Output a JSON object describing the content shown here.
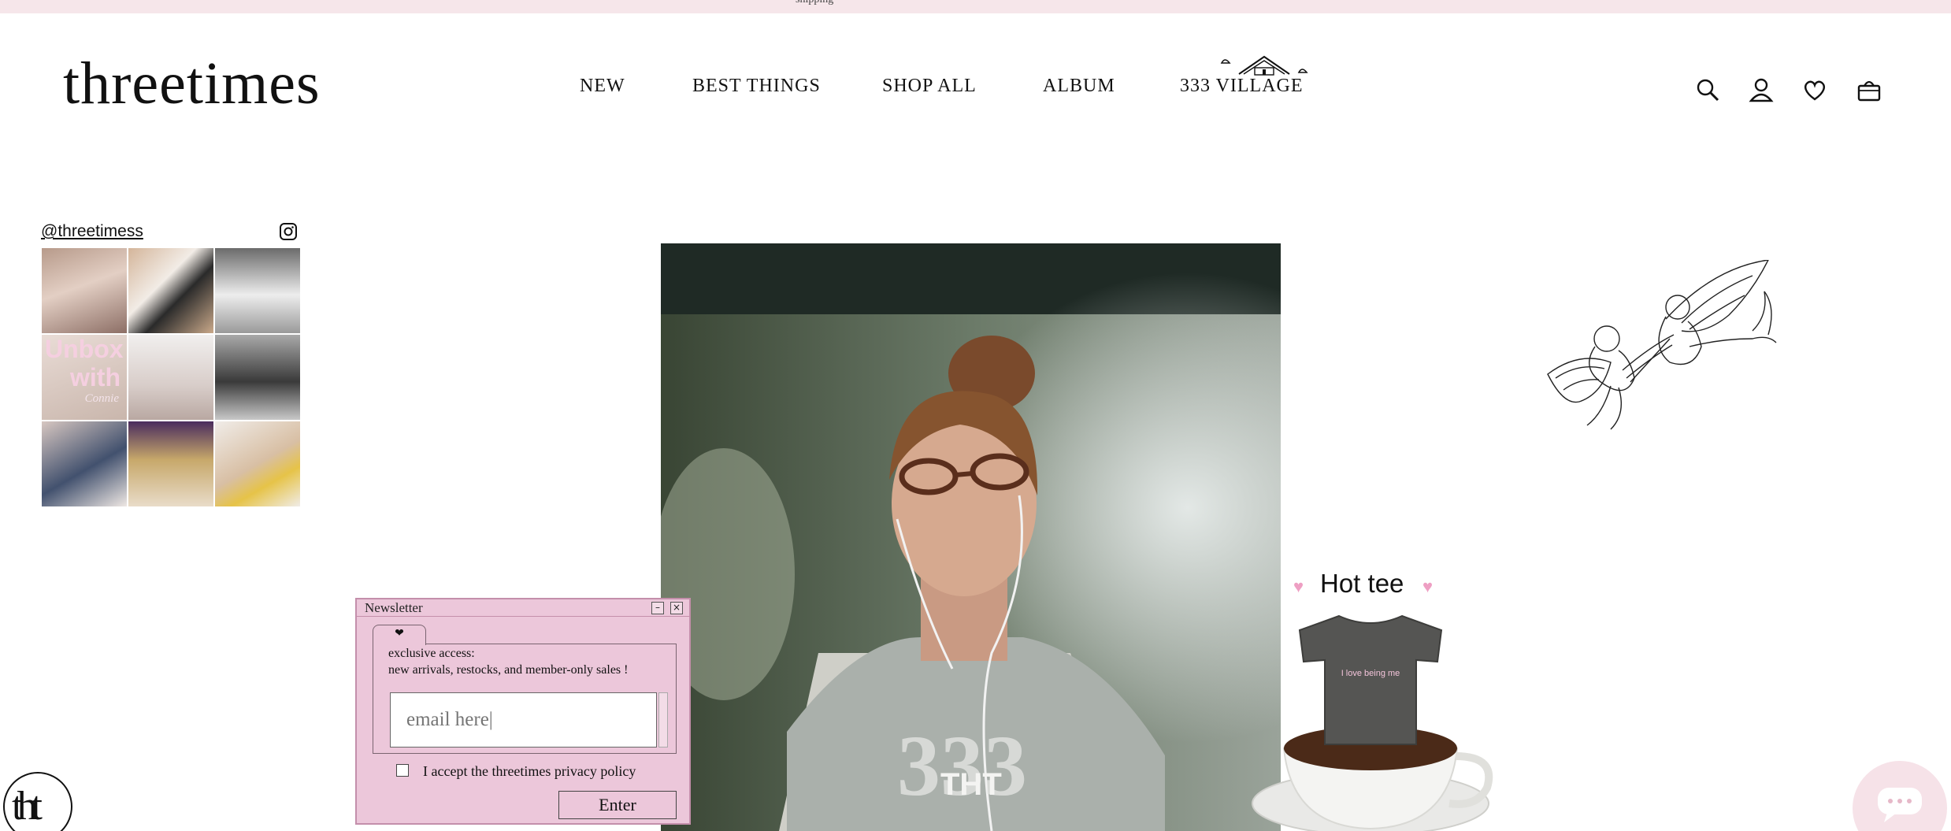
{
  "announcement": {
    "text": "shipping"
  },
  "brand": {
    "logo": "threetimes"
  },
  "nav": {
    "items": [
      "NEW",
      "BEST THINGS",
      "SHOP ALL",
      "ALBUM",
      "333 VILLAGE"
    ]
  },
  "header_icons": [
    "search-icon",
    "account-icon",
    "wishlist-heart-icon",
    "cart-bag-icon"
  ],
  "instagram": {
    "handle": "@threetimess",
    "tiles": [
      {
        "overlay": "",
        "overlay2": ""
      },
      {
        "overlay": "",
        "overlay2": ""
      },
      {
        "overlay": "",
        "overlay2": ""
      },
      {
        "overlay": "Unbox with",
        "overlay2": "Connie"
      },
      {
        "overlay": "",
        "overlay2": ""
      },
      {
        "overlay": "",
        "overlay2": ""
      },
      {
        "overlay": "",
        "overlay2": ""
      },
      {
        "overlay": "",
        "overlay2": ""
      },
      {
        "overlay": "",
        "overlay2": ""
      }
    ]
  },
  "product_feature": {
    "title": "Hot tee",
    "shirt_text": "I love being me"
  },
  "newsletter": {
    "window_title": "Newsletter",
    "minimize_label": "–",
    "close_label": "×",
    "tab_label": "❤",
    "line1": "exclusive access:",
    "line2": "new arrivals, restocks, and member-only sales !",
    "email_placeholder": "email here|",
    "accept_label": "I accept the threetimes privacy policy",
    "enter_label": "Enter"
  },
  "badge": {
    "text": "tht"
  },
  "colors": {
    "pink": "#ecc7da",
    "topbar": "#f6e6ea",
    "heart": "#ee9fc3"
  }
}
